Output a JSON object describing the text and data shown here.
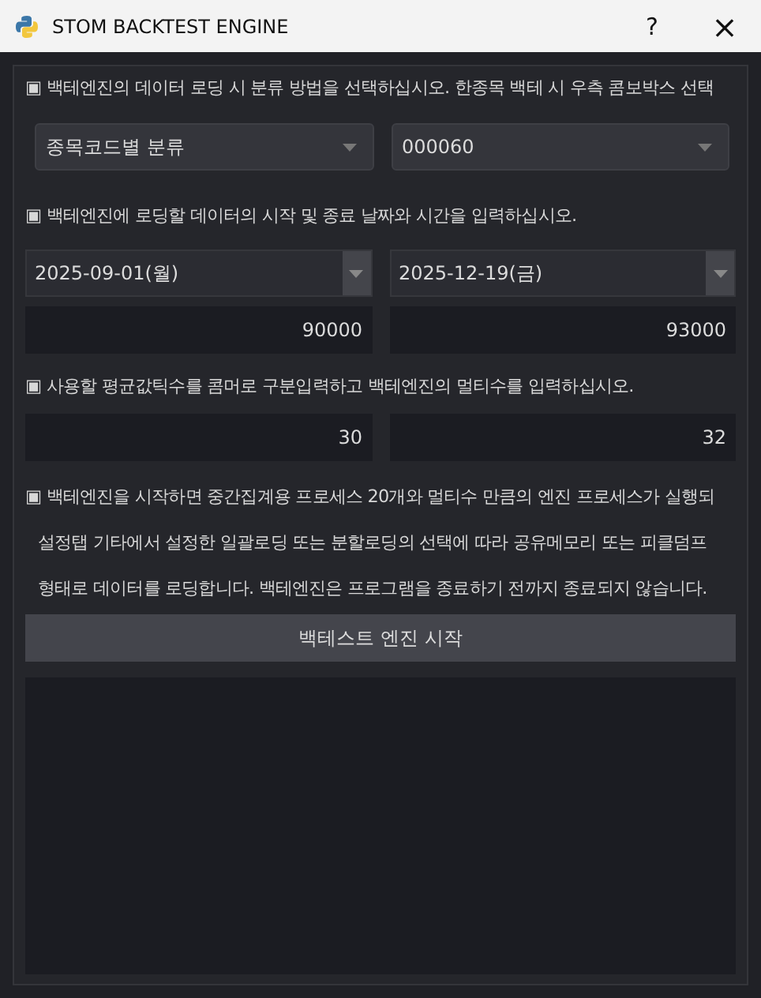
{
  "window": {
    "title": "STOM BACKTEST ENGINE",
    "help": "?",
    "close": "×"
  },
  "section_1": {
    "label": "▣ 백테엔진의 데이터 로딩 시 분류 방법을 선택하십시오. 한종목 백테 시 우측 콤보박스 선택",
    "combos": [
      {
        "value": "종목코드별 분류"
      },
      {
        "value": "000060"
      }
    ]
  },
  "section_2": {
    "label": "▣ 백테엔진에 로딩할 데이터의 시작 및 종료 날짜와 시간을 입력하십시오.",
    "dates": [
      {
        "value": "2025-09-01(월)"
      },
      {
        "value": "2025-12-19(금)"
      }
    ],
    "times": [
      {
        "value": "90000"
      },
      {
        "value": "93000"
      }
    ]
  },
  "section_3": {
    "label": "▣ 사용할 평균값틱수를 콤머로 구분입력하고 백테엔진의 멀티수를 입력하십시오.",
    "inputs": [
      {
        "value": "30"
      },
      {
        "value": "32"
      }
    ]
  },
  "notice": [
    "▣ 백테엔진을 시작하면 중간집계용 프로세스 20개와 멀티수 만큼의 엔진 프로세스가 실행되",
    "설정탭 기타에서 설정한 일괄로딩 또는 분할로딩의 선택에 따라 공유메모리 또는 피클덤프",
    "형태로 데이터를 로딩합니다. 백테엔진은 프로그램을 종료하기 전까지 종료되지 않습니다."
  ],
  "start_button": "백테스트 엔진 시작"
}
